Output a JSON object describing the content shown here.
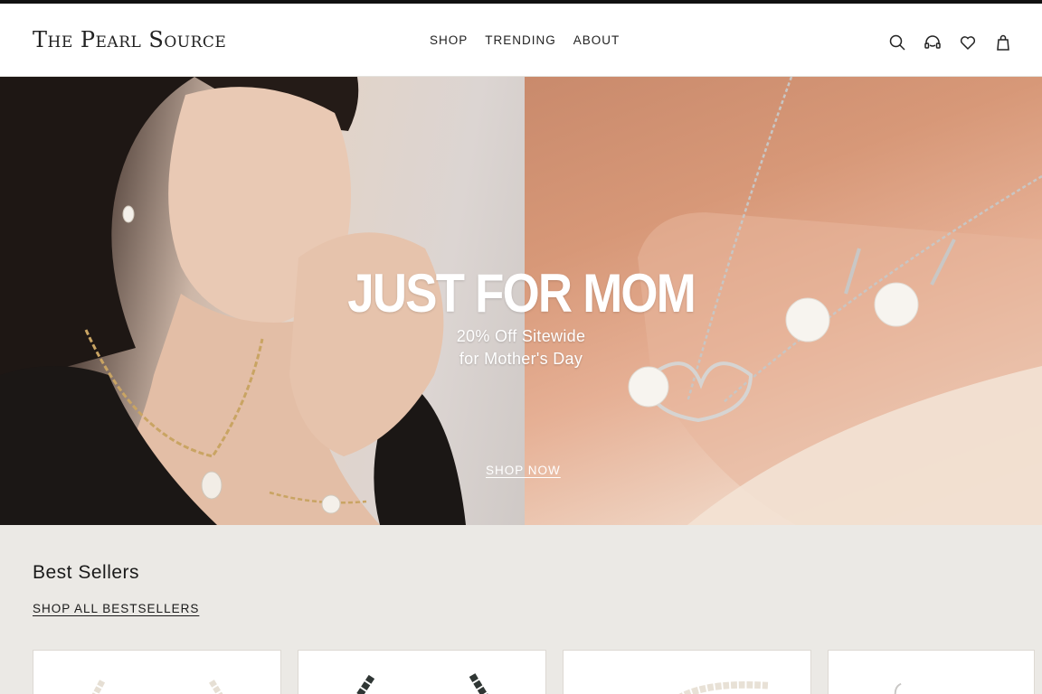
{
  "brand": {
    "logo_text": "The Pearl Source"
  },
  "nav": {
    "items": [
      {
        "label": "SHOP"
      },
      {
        "label": "TRENDING"
      },
      {
        "label": "ABOUT"
      }
    ]
  },
  "header_icons": [
    "search-icon",
    "headset-icon",
    "heart-icon",
    "shopping-bag-icon"
  ],
  "hero": {
    "title": "JUST FOR MOM",
    "subtitle_line1": "20% Off Sitewide",
    "subtitle_line2": "for Mother's Day",
    "cta_label": "SHOP NOW"
  },
  "bestsellers": {
    "title": "Best Sellers",
    "link_label": "SHOP ALL BESTSELLERS",
    "products": [
      {
        "image": "white pearl strand"
      },
      {
        "image": "black pearl strand"
      },
      {
        "image": "white pearl bracelet"
      },
      {
        "image": "silver jewelry"
      }
    ]
  },
  "colors": {
    "page_bg": "#ffffff",
    "section_bg": "#ebe9e5",
    "text": "#1a1a1a",
    "hero_warm": "#d79878"
  }
}
